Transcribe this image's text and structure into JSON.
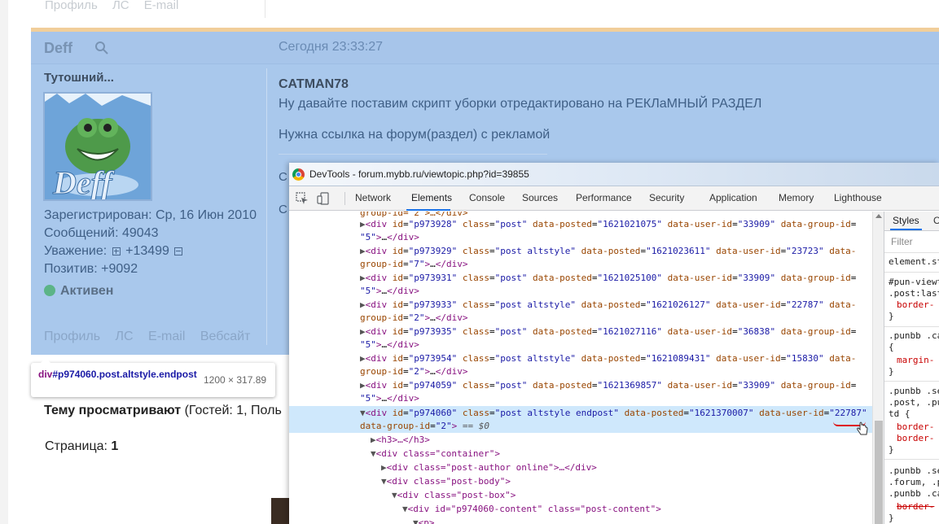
{
  "forum": {
    "top_links": [
      "Профиль",
      "ЛС",
      "E-mail"
    ],
    "post": {
      "author": "Deff",
      "time": "Сегодня 23:33:27",
      "user_title": "Тутошний...",
      "avatar_text": "Deff",
      "registered": "Зарегистрирован: Ср, 16 Июн 2010",
      "messages": "Сообщений: 49043",
      "respect_label": "Уважение:",
      "respect_value": "+13499",
      "positive": "Позитив: +9092",
      "status": "Активен",
      "bottom_links": [
        "Профиль",
        "ЛС",
        "E-mail",
        "Вебсайт"
      ],
      "quote_author": "CATMAN78",
      "line1": "Ну давайте поставим скрипт уборки отредактировано на РЕКЛаМНЫЙ РАЗДЕЛ",
      "line2": "Нужна ссылка на форум(раздел) с рекламой",
      "cut1": "С",
      "cut2": "С"
    },
    "viewing_bold": "Тему просматривают",
    "viewing_rest": " (Гостей: 1, Поль",
    "pages_label": "Страница:",
    "pages_value": "1"
  },
  "tooltip": {
    "selector_tag": "div",
    "selector_rest": "#p974060.post.altstyle.endpost",
    "dimensions": "1200 × 317.89"
  },
  "devtools": {
    "title": "DevTools - forum.mybb.ru/viewtopic.php?id=39855",
    "tabs": [
      "Network",
      "Elements",
      "Console",
      "Sources",
      "Performance",
      "Security",
      "Application",
      "Memory",
      "Lighthouse"
    ],
    "active_tab": "Elements",
    "styles_tab": "Styles",
    "styles_tab2": "C",
    "filter_placeholder": "Filter",
    "styles_lines": [
      "element.st",
      "#pun-viewt",
      ".post:last",
      "border-",
      "}",
      ".punbb .ca",
      "{",
      "margin-",
      "}",
      ".punbb .se",
      ".post, .pu",
      "td {",
      "border-",
      "border-",
      "}",
      ".punbb .se",
      ".forum, .p",
      ".punbb .ca",
      "border-",
      "}"
    ],
    "dom_lines": [
      {
        "id": "",
        "cls": "",
        "posted": "",
        "uid": "",
        "partial": "group-id=\"2\">…</div>"
      },
      {
        "id": "p973928",
        "cls": "post",
        "posted": "1621021075",
        "uid": "33909",
        "gid": "5"
      },
      {
        "id": "p973929",
        "cls": "post altstyle",
        "posted": "1621023611",
        "uid": "23723",
        "gid": "7"
      },
      {
        "id": "p973931",
        "cls": "post",
        "posted": "1621025100",
        "uid": "33909",
        "gid": "5"
      },
      {
        "id": "p973933",
        "cls": "post altstyle",
        "posted": "1621026127",
        "uid": "22787",
        "gid": "2"
      },
      {
        "id": "p973935",
        "cls": "post",
        "posted": "1621027116",
        "uid": "36838",
        "gid": "5"
      },
      {
        "id": "p973954",
        "cls": "post altstyle",
        "posted": "1621089431",
        "uid": "15830",
        "gid": "2"
      },
      {
        "id": "p974059",
        "cls": "post",
        "posted": "1621369857",
        "uid": "33909",
        "gid": "5"
      },
      {
        "id": "p974060",
        "cls": "post altstyle endpost",
        "posted": "1621370007",
        "uid": "22787",
        "gid": "2"
      }
    ],
    "selected_marker": "== $0",
    "child_h3": "<h3>…</h3>",
    "child_container": "<div class=\"container\">",
    "child_author": "<div class=\"post-author online\">…</div>",
    "child_body": "<div class=\"post-body\">",
    "child_box": "<div class=\"post-box\">",
    "child_content": "<div id=\"p974060-content\" class=\"post-content\">",
    "child_p": "<p>"
  }
}
